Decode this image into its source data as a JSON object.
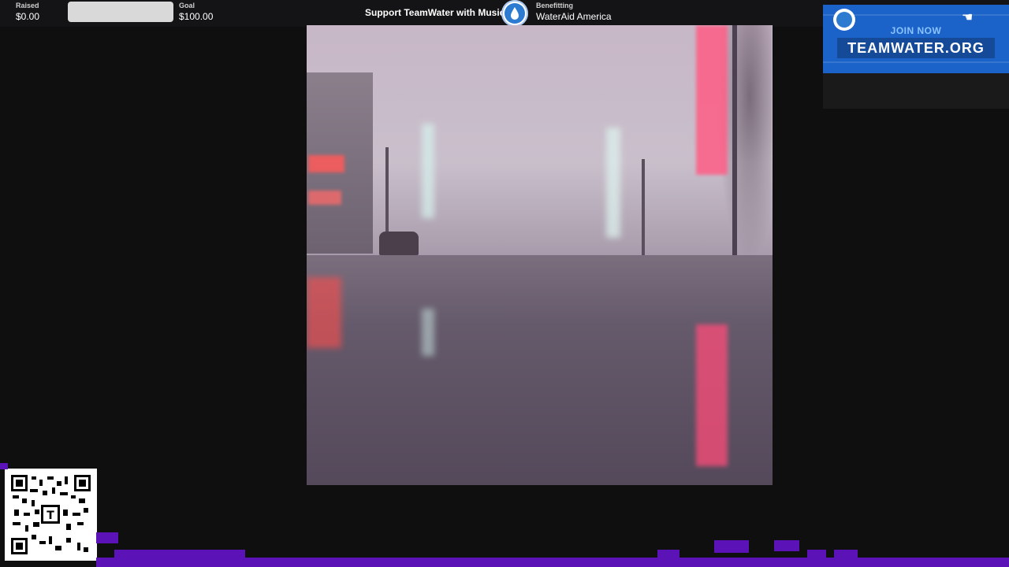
{
  "donation_bar": {
    "raised_label": "Raised",
    "raised_value": "$0.00",
    "progress_fraction": 0.0,
    "goal_label": "Goal",
    "goal_value": "$100.00",
    "campaign_title": "Support TeamWater with Music",
    "benefitting_label": "Benefitting",
    "benefitting_value": "WaterAid America"
  },
  "ad_banner": {
    "join_text": "JOIN NOW",
    "url_text": "TEAMWATER.ORG"
  },
  "icons": {
    "drop_badge": "water-drop-icon",
    "ad_logo": "water-drop-icon",
    "ad_pointer": "pointing-hand-icon",
    "qr": "qr-code-icon"
  },
  "colors": {
    "background": "#0f0f10",
    "topbar": "#141416",
    "ad_blue": "#1b63c9",
    "visualizer_purple": "#5b13b8"
  }
}
